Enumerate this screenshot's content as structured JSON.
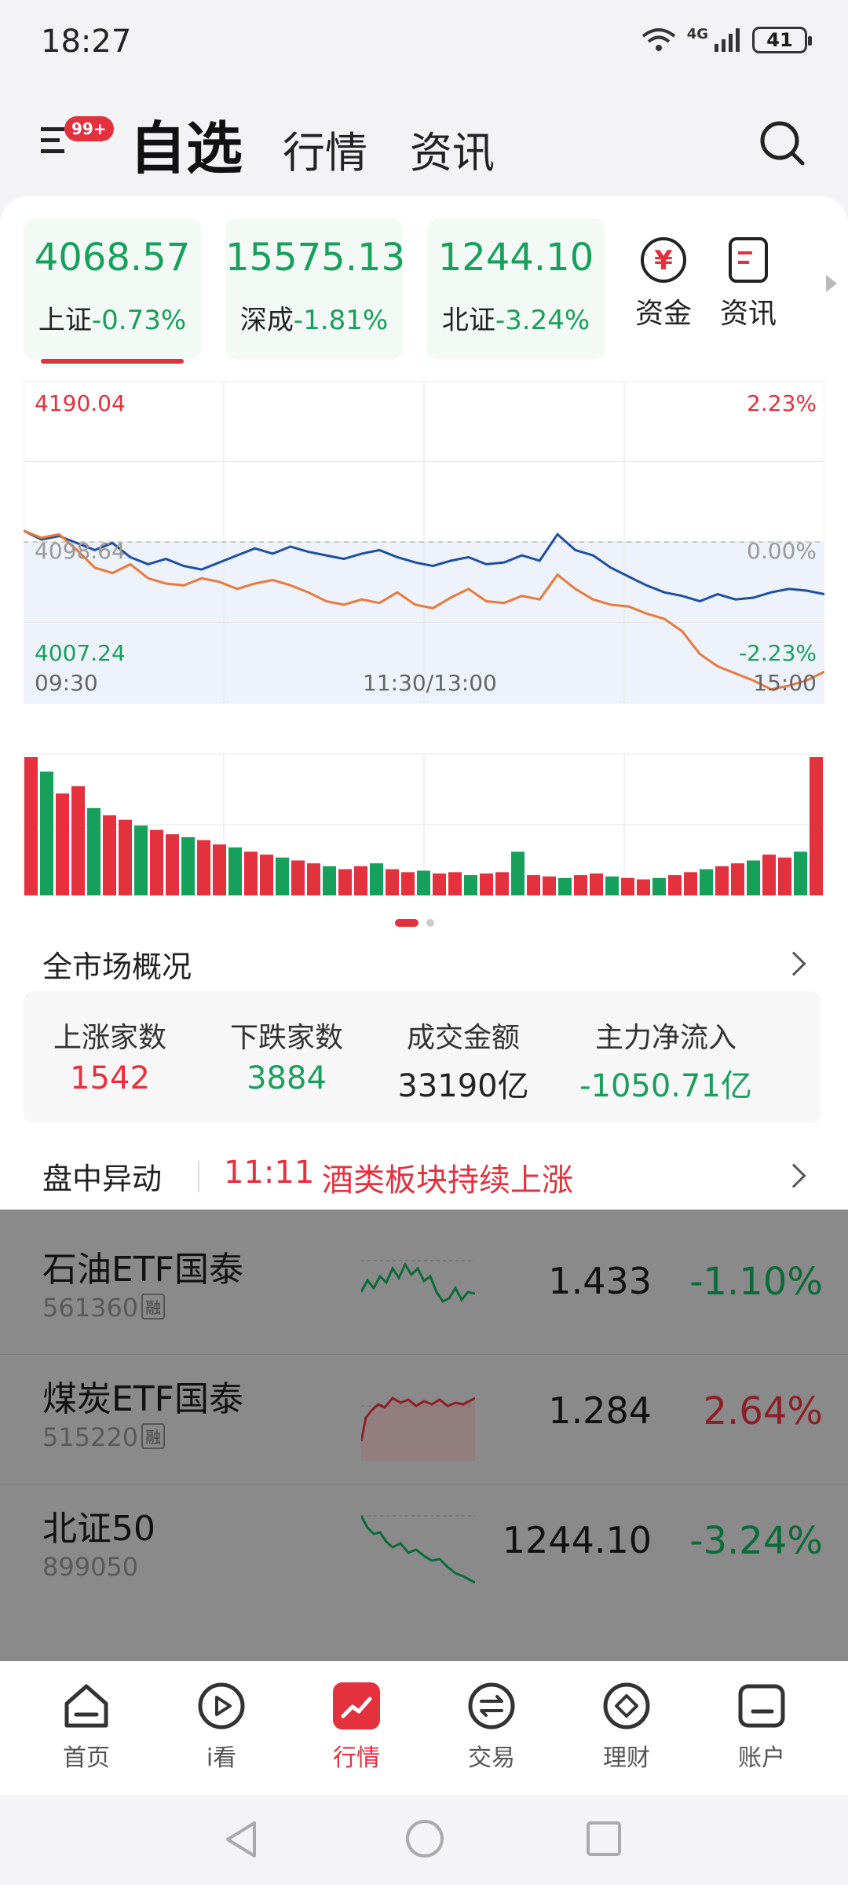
{
  "status": {
    "time": "18:27",
    "network": "4G",
    "battery": "41"
  },
  "header": {
    "badge": "99+",
    "tab_active": "自选",
    "tabs": [
      "行情",
      "资讯"
    ]
  },
  "indices": [
    {
      "value": "4068.57",
      "name": "上证",
      "change": "-0.73%"
    },
    {
      "value": "15575.13",
      "name": "深成",
      "change": "-1.81%"
    },
    {
      "value": "1244.10",
      "name": "北证",
      "change": "-3.24%"
    }
  ],
  "quick_links": [
    {
      "label": "资金",
      "icon": "yuan-icon"
    },
    {
      "label": "资讯",
      "icon": "news-icon"
    }
  ],
  "chart_data": {
    "type": "line",
    "y_labels": {
      "high": "4190.04",
      "mid": "4098.64",
      "low": "4007.24"
    },
    "pct_labels": {
      "high": "2.23%",
      "mid": "0.00%",
      "low": "-2.23%"
    },
    "x_labels": [
      "09:30",
      "11:30/13:00",
      "15:00"
    ],
    "ylim": [
      4007.24,
      4190.04
    ],
    "series": [
      {
        "color": "#1f4fa0",
        "values": [
          4105,
          4100,
          4102,
          4098,
          4094,
          4098,
          4090,
          4086,
          4089,
          4085,
          4083,
          4087,
          4091,
          4095,
          4092,
          4096,
          4093,
          4091,
          4089,
          4092,
          4094,
          4090,
          4087,
          4085,
          4088,
          4090,
          4086,
          4087,
          4091,
          4088,
          4103,
          4094,
          4091,
          4084,
          4079,
          4074,
          4070,
          4068,
          4065,
          4069,
          4066,
          4067,
          4070,
          4072,
          4071,
          4069
        ]
      },
      {
        "color": "#e87a3c",
        "values": [
          4105,
          4101,
          4103,
          4094,
          4084,
          4081,
          4086,
          4078,
          4075,
          4074,
          4078,
          4076,
          4072,
          4075,
          4077,
          4074,
          4070,
          4065,
          4063,
          4066,
          4064,
          4070,
          4063,
          4061,
          4067,
          4072,
          4065,
          4064,
          4068,
          4066,
          4080,
          4072,
          4066,
          4063,
          4062,
          4058,
          4055,
          4048,
          4035,
          4028,
          4024,
          4020,
          4015,
          4017,
          4020,
          4025
        ]
      }
    ],
    "volume": [
      95,
      85,
      70,
      75,
      60,
      55,
      52,
      48,
      45,
      42,
      40,
      38,
      35,
      33,
      30,
      28,
      26,
      24,
      22,
      20,
      18,
      20,
      22,
      18,
      16,
      17,
      15,
      16,
      14,
      15,
      16,
      30,
      14,
      13,
      12,
      14,
      15,
      13,
      12,
      11,
      12,
      14,
      16,
      18,
      20,
      22,
      24,
      28,
      26,
      30,
      95
    ]
  },
  "overview": {
    "title": "全市场概况",
    "stats": [
      {
        "label": "上涨家数",
        "value": "1542"
      },
      {
        "label": "下跌家数",
        "value": "3884"
      },
      {
        "label": "成交金额",
        "value": "33190亿"
      },
      {
        "label": "主力净流入",
        "value": "-1050.71亿"
      }
    ]
  },
  "alert": {
    "label": "盘中异动",
    "time": "11:11",
    "text": "酒类板块持续上涨"
  },
  "watchlist": [
    {
      "name": "石油ETF国泰",
      "code": "561360",
      "tag": "融",
      "price": "1.433",
      "change": "-1.10%",
      "trend": "down"
    },
    {
      "name": "煤炭ETF国泰",
      "code": "515220",
      "tag": "融",
      "price": "1.284",
      "change": "2.64%",
      "trend": "up"
    },
    {
      "name": "北证50",
      "code": "899050",
      "tag": "",
      "price": "1244.10",
      "change": "-3.24%",
      "trend": "down"
    }
  ],
  "nav": [
    {
      "label": "首页",
      "icon": "home-icon"
    },
    {
      "label": "i看",
      "icon": "play-icon"
    },
    {
      "label": "行情",
      "icon": "market-icon"
    },
    {
      "label": "交易",
      "icon": "trade-icon"
    },
    {
      "label": "理财",
      "icon": "finance-icon"
    },
    {
      "label": "账户",
      "icon": "account-icon"
    }
  ]
}
